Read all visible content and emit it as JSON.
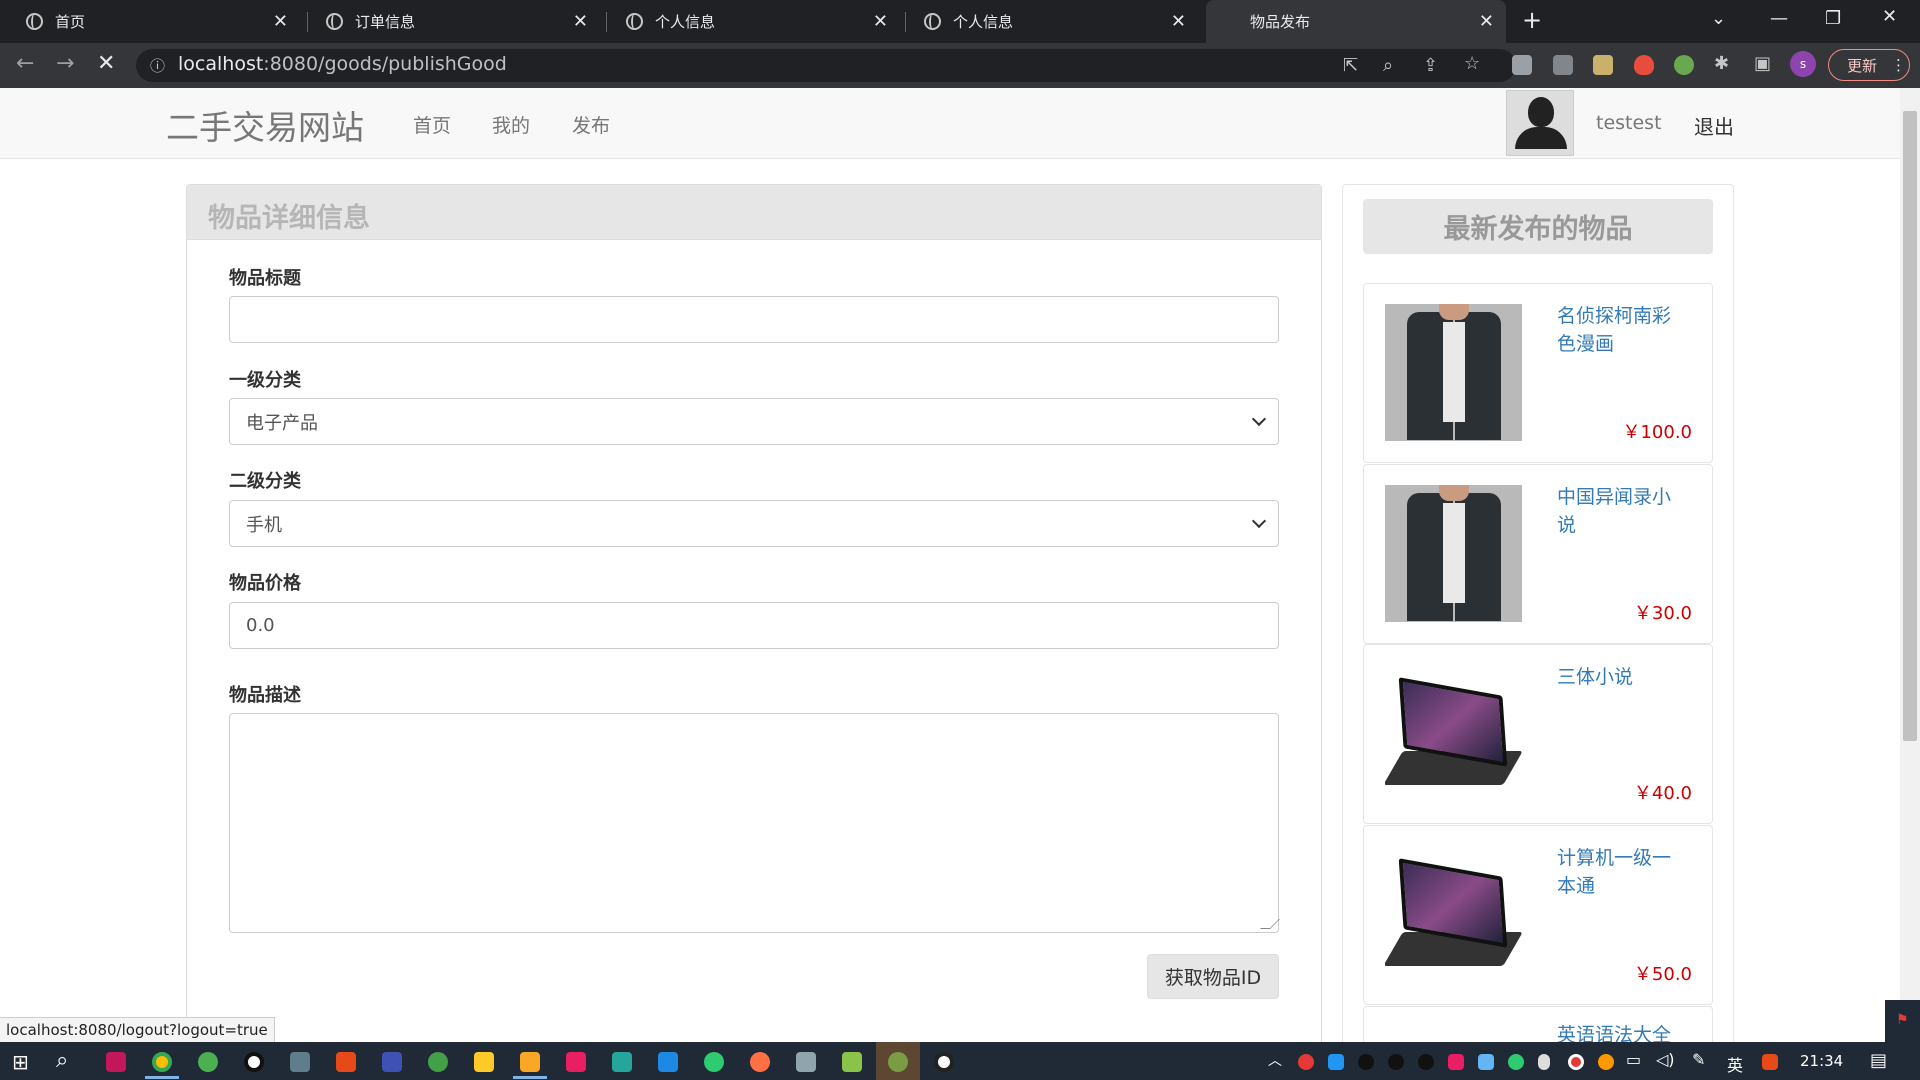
{
  "browser": {
    "tabs": [
      {
        "label": "首页",
        "active": false
      },
      {
        "label": "订单信息",
        "active": false
      },
      {
        "label": "个人信息",
        "active": false
      },
      {
        "label": "个人信息",
        "active": false
      },
      {
        "label": "物品发布",
        "active": true
      }
    ],
    "url_host": "localhost",
    "url_path": ":8080/goods/publishGood",
    "update_label": "更新",
    "profile_initial": "s",
    "status_url": "localhost:8080/logout?logout=true"
  },
  "site": {
    "brand": "二手交易网站",
    "nav": [
      "首页",
      "我的",
      "发布"
    ],
    "username": "testest",
    "logout": "退出"
  },
  "form": {
    "panel_title": "物品详细信息",
    "title_label": "物品标题",
    "title_value": "",
    "category1_label": "一级分类",
    "category1_value": "电子产品",
    "category2_label": "二级分类",
    "category2_value": "手机",
    "price_label": "物品价格",
    "price_value": "0.0",
    "desc_label": "物品描述",
    "desc_value": "",
    "get_id_button": "获取物品ID"
  },
  "latest": {
    "title": "最新发布的物品",
    "items": [
      {
        "title": "名侦探柯南彩色漫画",
        "price": "￥100.0",
        "image": "jacket"
      },
      {
        "title": "中国异闻录小说",
        "price": "￥30.0",
        "image": "jacket"
      },
      {
        "title": "三体小说",
        "price": "￥40.0",
        "image": "laptop"
      },
      {
        "title": "计算机一级一本通",
        "price": "￥50.0",
        "image": "laptop"
      },
      {
        "title": "英语语法大全",
        "price": "",
        "image": "laptop"
      }
    ]
  },
  "taskbar": {
    "ime": "英",
    "time": "21:34"
  },
  "colors": {
    "link": "#337ab7",
    "price": "#cc0000",
    "chrome_bg": "#202124"
  }
}
